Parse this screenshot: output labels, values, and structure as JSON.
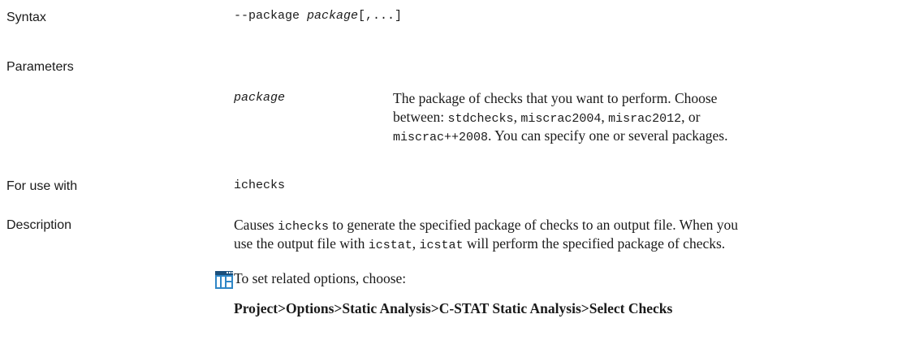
{
  "syntax": {
    "heading": "Syntax",
    "option": "--package ",
    "arg": "package",
    "rest": "[,...]"
  },
  "parameters": {
    "heading": "Parameters",
    "name": "package",
    "line1": "The package of checks that you want to perform. Choose",
    "line2_pre": "between: ",
    "pkg_stdchecks": "stdchecks",
    "sep1": ", ",
    "pkg_miscrac2004": "miscrac2004",
    "sep2": ", ",
    "pkg_misrac2012": "misrac2012",
    "sep3": ", or",
    "pkg_miscracpp2008": "miscrac++2008",
    "line3_post": ". You can specify one or several packages."
  },
  "for_use_with": {
    "heading": "For use with",
    "tool": "ichecks"
  },
  "description": {
    "heading": "Description",
    "l1_pre": "Causes ",
    "l1_code": "ichecks",
    "l1_post": " to generate the specified package of checks to an output file. When you",
    "l2_pre": "use the output file with ",
    "l2_code1": "icstat",
    "l2_mid": ", ",
    "l2_code2": "icstat",
    "l2_post": " will perform the specified package of checks.",
    "tip_text": "To set related options, choose:",
    "menu_path": "Project>Options>Static Analysis>C-STAT Static Analysis>Select Checks",
    "tip_icon": "ide-window-icon"
  }
}
